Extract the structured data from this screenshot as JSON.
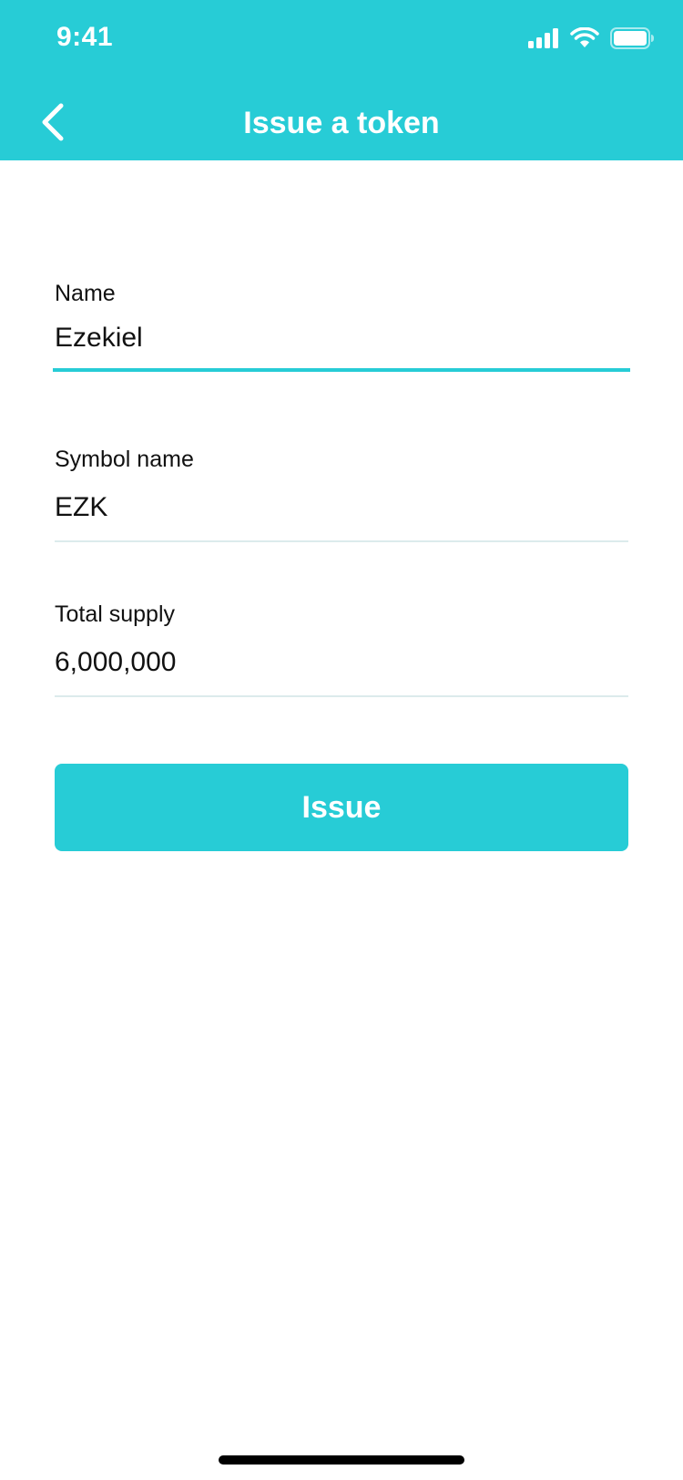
{
  "status_bar": {
    "time": "9:41",
    "icons": [
      "signal-icon",
      "wifi-icon",
      "battery-icon"
    ]
  },
  "header": {
    "title": "Issue a token",
    "back_icon": "chevron-left-icon",
    "background_color": "#27ccd6"
  },
  "form": {
    "name": {
      "label": "Name",
      "value": "Ezekiel"
    },
    "symbol": {
      "label": "Symbol name",
      "value": "EZK"
    },
    "supply": {
      "label": "Total supply",
      "value": "6,000,000"
    }
  },
  "actions": {
    "issue_label": "Issue"
  },
  "colors": {
    "accent": "#27ccd6",
    "divider": "#dcebec",
    "text": "#111111"
  }
}
